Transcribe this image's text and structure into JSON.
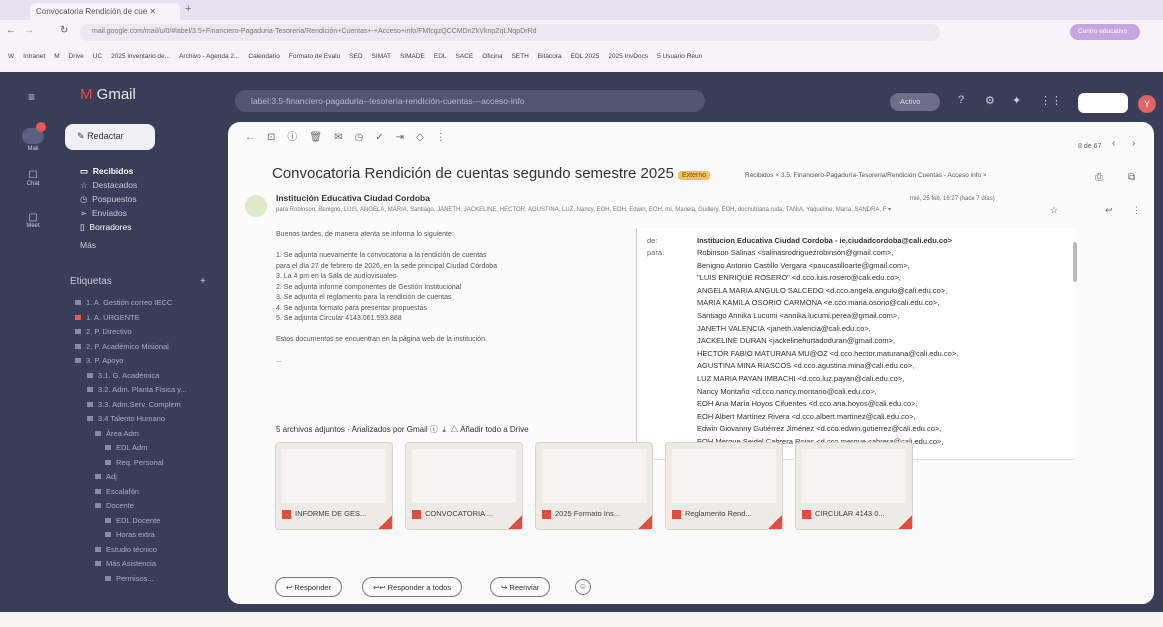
{
  "browser": {
    "tab_title": "Convocatoria Rendición de cue",
    "url": "mail.google.com/mail/u/0/#label/3.5+Financiero-Pagaduria-Tesorería/Rendición+Cuentas+-+Acceso+info/FMfcgzQCCMDnZkVknpZqLNqpDrRd",
    "bookmarks": [
      "W",
      "Intranet",
      "M",
      "Drive",
      "UC",
      "2025 inventario de...",
      "Archivo - Agenda 2...",
      "Calendario",
      "Formato de Evalu",
      "SED",
      "SIMAT",
      "SIMADE",
      "EDL",
      "SACE",
      "Oficina",
      "SETH",
      "Bitácora",
      "EDL 2025",
      "2025 InvDocs",
      "5 Usuario Reun"
    ]
  },
  "gmail": {
    "logo": "Gmail",
    "search": "label:3.5-financiero-pagaduria--tesorería-rendición-cuentas---acceso-info",
    "status": "Activo",
    "avatar": "Y",
    "compose": "Redactar",
    "rail": [
      "Mail",
      "Chat",
      "Meet"
    ],
    "nav": [
      "Recibidos",
      "Destacados",
      "Pospuestos",
      "Enviados",
      "Borradores",
      "Más"
    ],
    "labels_title": "Etiquetas",
    "labels": [
      "1. A. Gestión correo IECC",
      "1. A. URGENTE",
      "2. P. Directivo",
      "2. P. Académico Misional",
      "3. P. Apoyo",
      "3.1. G. Académica",
      "3.2. Adm. Planta Física y...",
      "3.3. Adm.Serv. Complem",
      "3.4 Talento Humano",
      "Área Adm",
      "EDL Adm",
      "Req. Personal",
      "Adj",
      "Escalafón",
      "Docente",
      "EDL Docente",
      "Horas extra",
      "Estudio técnico",
      "Más Asistencia",
      "Permisos..."
    ]
  },
  "email": {
    "page_count": "8 de 67",
    "subject": "Convocatoria Rendición de cuentas segundo semestre 2025",
    "badge": "Externo",
    "chips": "Recibidos ×    3.5. Financiero-Pagaduría-Tesorería/Rendición Cuentas - Acceso info ×",
    "sender": "Institución Educativa Ciudad Cordoba",
    "recipients_short": "para Robinson, Benigno, LUIS, ANGELA, MARIA, Santiago, JANETH, JACKELINE, HECTOR, AGUSTINA, LUZ, Nancy, EOH, EOH, Edwin, EOH, mí, Mariela, Guillery, EOH, docnublana.ruda, TANIA, Yaqueline, María, SANDRA, F ▾",
    "date": "mié, 25 feb, 16:27 (hace 7 días)",
    "body": [
      "Buenos tardes, de manera atenta se informa lo siguiente:",
      "",
      "1. Se adjunta nuevamente la convocatoria a la rendición de cuentas",
      "para el día 27 de febrero de 2026, en la sede principal Ciudad Córdoba",
      "3. La 4 pm en la Sala de audiovisuales",
      "2. Se adjunta informe componentes de Gestión Institucional",
      "3. Se adjunta el reglamento para la rendición de cuentas",
      "4. Se adjunta formato para presentar propuestas",
      "5. Se adjunta Circular 4143.061.593.888",
      "",
      "Estos documentos se encuentran en la página web de la institución.",
      "",
      "..."
    ],
    "details": {
      "de_label": "de:",
      "de_value": "Institucion Educativa Ciudad Cordoba - ie.ciudadcordoba@cali.edu.co>",
      "para_label": "para:",
      "para_values": [
        "Robinson Salinas <salinasrodriguezrobinson@gmail.com>,",
        "Benigno Antonio Castillo Vergara <paucastilloarte@gmail.com>,",
        "\"LUIS ENRIQUE ROSERO\" <d.cco.luis.rosero@cali.edu.co>,",
        "ANGELA MARIA ANGULO SALCEDO <d.cco.angela.angulo@cali.edu.co>,",
        "MARIA KAMILA OSORIO CARMONA <e.cco.maria.osorio@cali.edu.co>,",
        "Santiago Annika Lucumi <annika.lucumi.perea@gmail.com>,",
        "JANETH VALENCIA <janeth.valencia@cali.edu.co>,",
        "JACKELINE DURAN <jackelinehurtadoduran@gmail.com>,",
        "HECTOR FABIO MATURANA MU@OZ <d.cco.hector.maturana@cali.edu.co>,",
        "AGUSTINA MINA RIASCOS <d.cco.agustina.mina@cali.edu.co>,",
        "LUZ MARIA PAYAN IMBACHI <d.cco.luz.payan@cali.edu.co>,",
        "Nancy Montaño <d.cco.nancy.montano@cali.edu.co>,",
        "EOH Ana María Hoyos Cifuentes <d.cco.ana.hoyos@cali.edu.co>,",
        "EOH Albert Martínez Rivera <d.cco.albert.martinez@cali.edu.co>,",
        "Edwin Giovanny Gutiérrez Jiménez <d.cco.edwin.gutierrez@cali.edu.co>,",
        "EOH Merque Seidel Cabrera Rojas <d.cco.merque.cabrera@cali.edu.co>,"
      ]
    },
    "attachments_title": "5 archivos adjuntos · Analizados por Gmail ⓘ",
    "add_all_drive": "Añadir todo a Drive",
    "attachments": [
      "INFORME DE GES...",
      "CONVOCATORIA ...",
      "2025 Formato Ins...",
      "Reglamento Rend...",
      "CIRCULAR 4143 0..."
    ],
    "actions": {
      "reply": "Responder",
      "reply_all": "Responder a todos",
      "forward": "Reenviar"
    }
  }
}
